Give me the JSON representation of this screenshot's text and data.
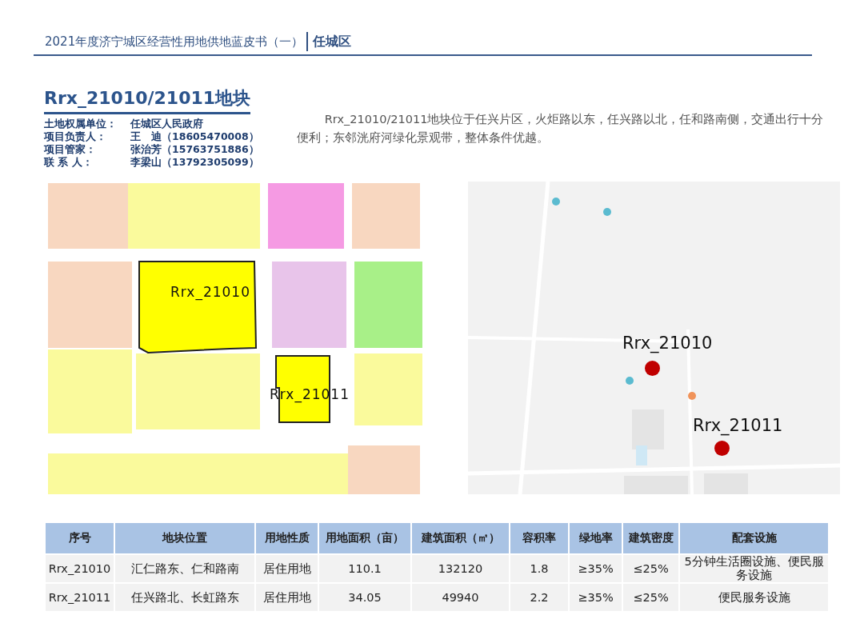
{
  "header": {
    "title": "2021年度济宁城区经营性用地供地蓝皮书（一）",
    "district": "任城区"
  },
  "plot": {
    "title": "Rrx_21010/21011地块",
    "info": [
      {
        "label": "土地权属单位：",
        "value": "任城区人民政府"
      },
      {
        "label": "项目负责人：",
        "value": "王　迪（18605470008）"
      },
      {
        "label": "项目管家：",
        "value": "张治芳（15763751886）"
      },
      {
        "label": "联 系 人：",
        "value": "李梁山（13792305099）"
      }
    ],
    "description": "Rrx_21010/21011地块位于任兴片区，火炬路以东，任兴路以北，任和路南侧，交通出行十分便利；东邻洸府河绿化景观带，整体条件优越。"
  },
  "planning_map": {
    "kind": "picture",
    "labels": [
      "Rrx_21010",
      "Rrx_21011"
    ]
  },
  "location_map": {
    "kind": "picture",
    "markers": [
      {
        "label": "Rrx_21010",
        "color": "#c00000"
      },
      {
        "label": "Rrx_21011",
        "color": "#c00000"
      }
    ]
  },
  "table": {
    "columns": [
      "序号",
      "地块位置",
      "用地性质",
      "用地面积（亩）",
      "建筑面积（㎡）",
      "容积率",
      "绿地率",
      "建筑密度",
      "配套设施"
    ],
    "rows": [
      [
        "Rrx_21010",
        "汇仁路东、仁和路南",
        "居住用地",
        "110.1",
        "132120",
        "1.8",
        "≥35%",
        "≤25%",
        "5分钟生活圈设施、便民服务设施"
      ],
      [
        "Rrx_21011",
        "任兴路北、长虹路东",
        "居住用地",
        "34.05",
        "49940",
        "2.2",
        "≥35%",
        "≤25%",
        "便民服务设施"
      ]
    ]
  }
}
